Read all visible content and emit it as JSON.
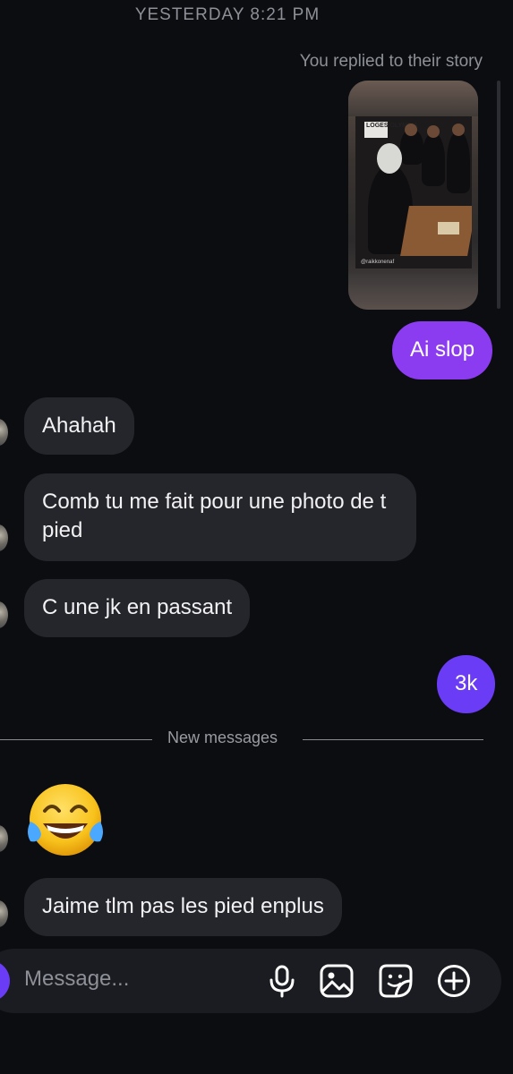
{
  "thread": {
    "timestamp": "YESTERDAY 8:21 PM",
    "story_reply_note": "You replied to their story",
    "story_thumbnail": {
      "sign_text": "LOGES OLYMPIA",
      "handle": "@raikkonenaf"
    }
  },
  "messages": [
    {
      "from": "me",
      "text": "Ai slop"
    },
    {
      "from": "them",
      "text": "Ahahah"
    },
    {
      "from": "them",
      "text": "Comb tu me fait pour une photo de t pied"
    },
    {
      "from": "them",
      "text": "C une jk en passant"
    },
    {
      "from": "me",
      "text": "3k"
    },
    {
      "from": "them",
      "text": "Jaime tlm pas les pied enplus"
    }
  ],
  "divider": {
    "label": "New messages"
  },
  "emoji_message": {
    "icon": "face-with-tears-of-joy-icon"
  },
  "composer": {
    "placeholder": "Message...",
    "icons": [
      "camera-icon",
      "microphone-icon",
      "gallery-icon",
      "sticker-icon",
      "add-icon"
    ]
  },
  "colors": {
    "background": "#0c0d11",
    "outgoing_bubble": "#8c3cf0",
    "outgoing_bubble_alt": "#6a3cf5",
    "incoming_bubble": "#25262b",
    "muted_text": "#8e9098"
  }
}
